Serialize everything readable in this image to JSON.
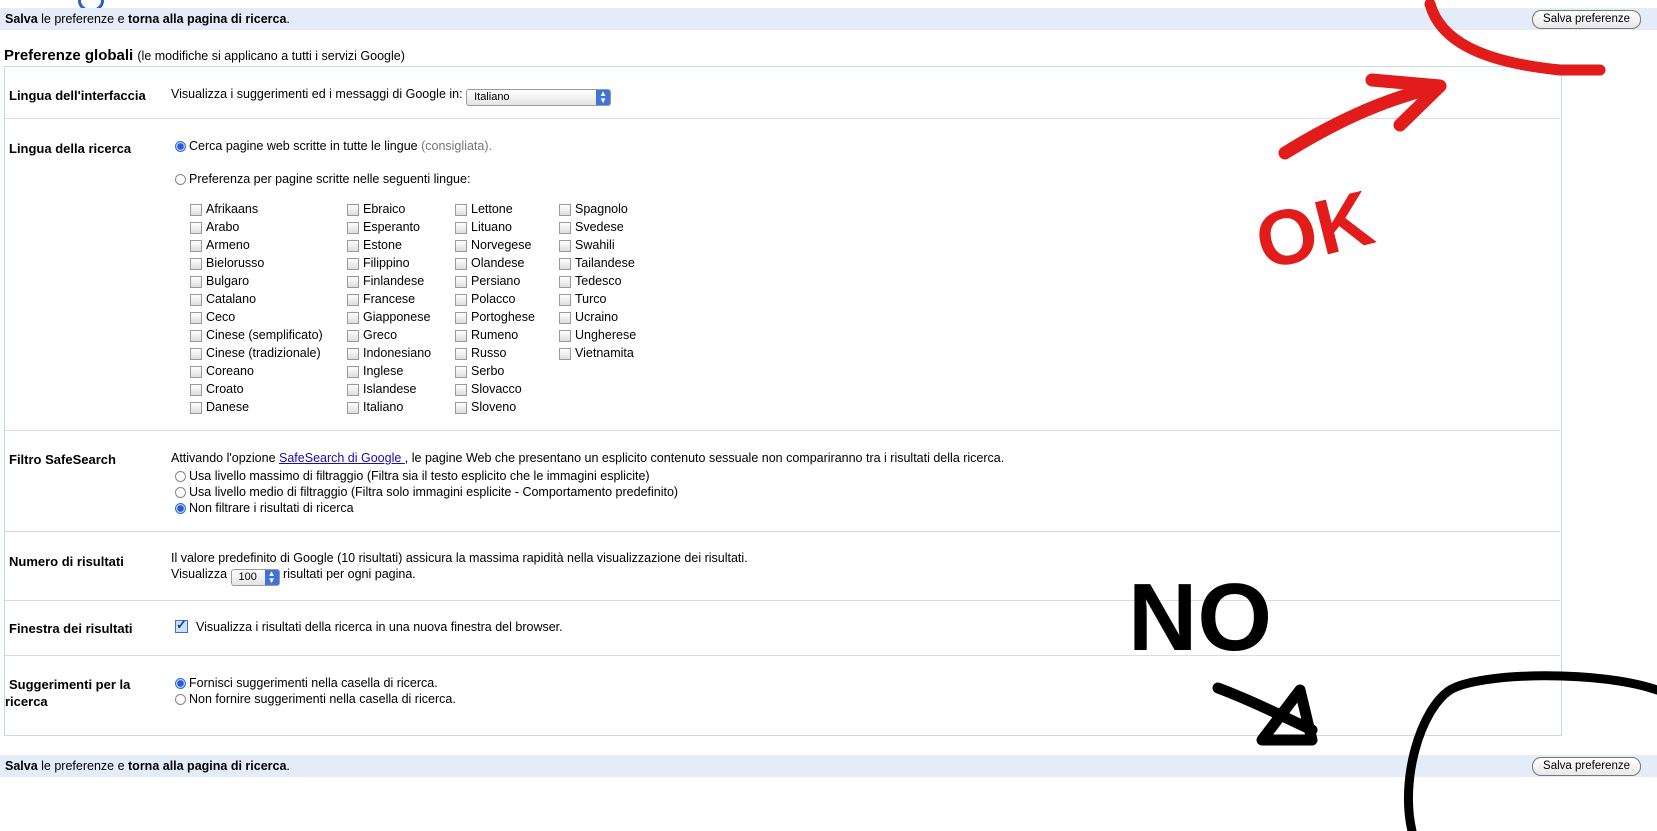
{
  "top_bar": {
    "save_bold": "Salva",
    "mid": " le preferenze e ",
    "return_bold": "torna alla pagina di ricerca",
    "end": ".",
    "button": "Salva preferenze"
  },
  "bottom_bar": {
    "save_bold": "Salva",
    "mid": " le preferenze e ",
    "return_bold": "torna alla pagina di ricerca",
    "end": ".",
    "button": "Salva preferenze"
  },
  "global": {
    "title": "Preferenze globali",
    "subtitle": "(le modifiche si applicano a tutti i servizi Google)"
  },
  "interface_lang": {
    "label": "Lingua dell'interfaccia",
    "text": "Visualizza i suggerimenti ed i messaggi di Google in:",
    "selected": "Italiano"
  },
  "search_lang": {
    "label": "Lingua della ricerca",
    "option_all": "Cerca pagine web scritte in tutte le lingue",
    "option_all_note": "(consigliata).",
    "option_pref": "Preferenza per pagine scritte nelle seguenti lingue:",
    "languages": [
      "Afrikaans",
      "Arabo",
      "Armeno",
      "Bielorusso",
      "Bulgaro",
      "Catalano",
      "Ceco",
      "Cinese (semplificato)",
      "Cinese (tradizionale)",
      "Coreano",
      "Croato",
      "Danese",
      "Ebraico",
      "Esperanto",
      "Estone",
      "Filippino",
      "Finlandese",
      "Francese",
      "Giapponese",
      "Greco",
      "Indonesiano",
      "Inglese",
      "Islandese",
      "Italiano",
      "Lettone",
      "Lituano",
      "Norvegese",
      "Olandese",
      "Persiano",
      "Polacco",
      "Portoghese",
      "Rumeno",
      "Russo",
      "Serbo",
      "Slovacco",
      "Sloveno",
      "Spagnolo",
      "Svedese",
      "Swahili",
      "Tailandese",
      "Tedesco",
      "Turco",
      "Ucraino",
      "Ungherese",
      "Vietnamita"
    ]
  },
  "safesearch": {
    "label": "Filtro SafeSearch",
    "intro_pre": "Attivando l'opzione ",
    "intro_link": "SafeSearch di Google ",
    "intro_post": ", le pagine Web che presentano un esplicito contenuto sessuale non compariranno tra i risultati della ricerca.",
    "opt_strict": "Usa livello massimo di filtraggio (Filtra sia il testo esplicito che le immagini esplicite)",
    "opt_moderate": "Usa livello medio di filtraggio (Filtra solo immagini esplicite - Comportamento predefinito)",
    "opt_off": "Non filtrare i risultati di ricerca"
  },
  "num_results": {
    "label": "Numero di risultati",
    "line1": "Il valore predefinito di Google (10 risultati) assicura la massima rapidità nella visualizzazione dei risultati.",
    "pre": "Visualizza",
    "selected": "100",
    "post": "risultati per ogni pagina."
  },
  "results_window": {
    "label": "Finestra dei risultati",
    "text": "Visualizza i risultati della ricerca in una nuova finestra del browser."
  },
  "suggestions": {
    "label_1": "Suggerimenti per la",
    "label_2": "ricerca",
    "opt_on": "Fornisci suggerimenti nella casella di ricerca.",
    "opt_off": "Non fornire suggerimenti nella casella di ricerca."
  },
  "annotations": {
    "ok": "OK",
    "no": "NO",
    "ok_color": "#e21b1b",
    "no_color": "#000000"
  }
}
